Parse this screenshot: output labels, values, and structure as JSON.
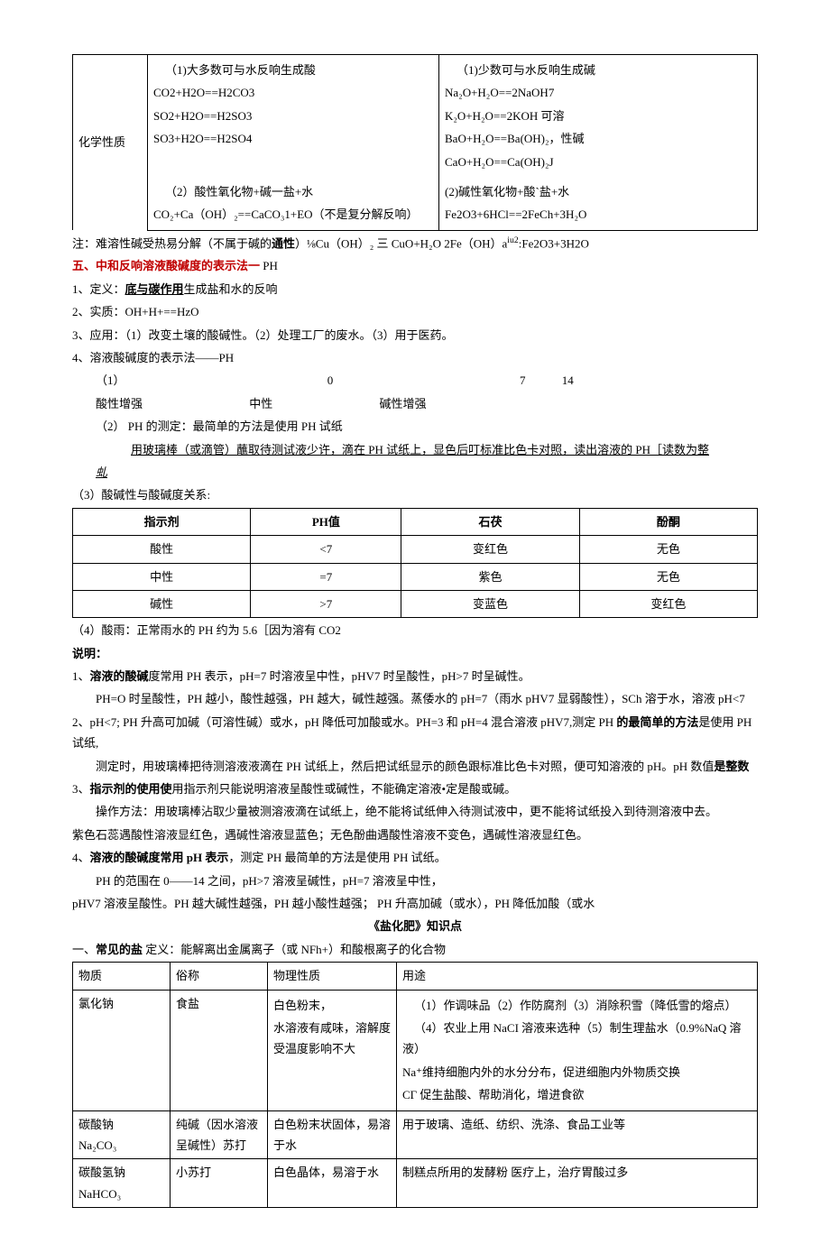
{
  "table1": {
    "rowLabel": "化学性质",
    "c1a": "（1)大多数可与水反响生成酸",
    "c1b1": "CO2+H2O==H2CO3",
    "c1b2": "SO2+H2O==H2SO3",
    "c1b3": "SO3+H2O==H2SO4",
    "c2a": "（1)少数可与水反响生成碱",
    "c2b1": "Na₂O+H₂O==2NaOH7",
    "c2b2": "K₂O+H₂O==2KOH          可溶",
    "c2b3": "BaO+H₂O==Ba(OH)₂，性碱",
    "c2b4": "CaO+H₂O==Ca(OH)₂J",
    "c3a": "（2）酸性氧化物+碱一盐+水",
    "c3b": "CO₂+Ca（OH）₂==CaCO₃1+EO（不是复分解反响）",
    "c4a": "(2)碱性氧化物+酸`盐+水",
    "c4b": "Fe2O3+6HCl==2FeCh+3H₂O"
  },
  "note1": "注：难溶性碱受热易分解（不属于碱的",
  "note1b": "通性",
  "note1c": "）⅛Cu（OH）₂ 三 CuO+H₂O            2Fe（OH）a",
  "note1d": ":Fe2O3+3H2O",
  "note1sup": "iu2",
  "sec5": {
    "title": "五、中和反响溶液酸碱度的表示法一",
    "titleSuffix": " PH",
    "p1a": "1、定义：",
    "p1b": "底与碳作用",
    "p1c": "生成盐和水的反响",
    "p2": "2、实质：OH+H+==HzO",
    "p3": "3、应用：（1）改变土壤的酸碱性。（2）处理工厂的废水。（3）用于医药。",
    "p4": "4、溶液酸碱度的表示法——PH",
    "scale1": "（1）",
    "scale2": "0",
    "scale3": "7",
    "scale4": "14",
    "scaleL": "酸性增强",
    "scaleM": "中性",
    "scaleR": "碱性增强",
    "p42": "（2） PH 的测定：最简单的方法是使用 PH 试纸",
    "p42b": "用玻璃棒（或滴管）蘸取待测试液少许，滴在 PH 试纸上，显色后叮标准比色卡对照，读出溶液的 PH［读数为整",
    "p42c": "虬",
    "p43": "（3）酸碱性与酸碱度关系:"
  },
  "table3": {
    "h1": "指示剂",
    "h2": "PH值",
    "h3": "石茯",
    "h4": "酚酮",
    "r1c1": "酸性",
    "r1c2": "<7",
    "r1c3": "变红色",
    "r1c4": "无色",
    "r2c1": "中性",
    "r2c2": "=7",
    "r2c3": "紫色",
    "r2c4": "无色",
    "r3c1": "碱性",
    "r3c2": ">7",
    "r3c3": "变蓝色",
    "r3c4": "变红色"
  },
  "p44": "（4）酸雨：正常雨水的 PH 约为 5.6［因为溶有 CO2",
  "explain": {
    "title": "说明：",
    "p1a": "1、",
    "p1b": "溶液的酸碱",
    "p1c": "度常用 PH 表示，pH=7 时溶液呈中性，pHV7 时呈酸性，pH>7 时呈碱性。",
    "p1d": "PH=O 时呈酸性，PH 越小，酸性越强，PH 越大，碱性越强。蒸倭水的 pH=7（雨水 pHV7 显弱酸性），SCh 溶于水，溶液 pH<7",
    "p2a": "2、pH<7;  PH 升高可加碱（可溶性碱）或水，pH 降低可加酸或水。PH=3 和 pH=4 混合溶液 pHV7,测定 PH ",
    "p2b": "的最简单的方法",
    "p2c": "是使用 PH 试纸,",
    "p2d": "测定时，用玻璃棒把待测溶液液滴在 PH 试纸上，然后把试纸显示的颜色跟标准比色卡对照，便可知溶液的 pH。pH 数值",
    "p2e": "是整数",
    "p3a": "3、",
    "p3b": "指示剂的使用使",
    "p3c": "用指示剂只能说明溶液呈酸性或碱性，不能确定溶液•定是酸或碱。",
    "p3d": "操作方法：用玻璃棒沾取少量被测溶液滴在试纸上，绝不能将试纸伸入待测试液中，更不能将试纸投入到待测溶液中去。",
    "p3e": "紫色石蕊遇酸性溶液显红色，遇碱性溶液显蓝色；无色酚曲遇酸性溶液不变色，遇碱性溶液显红色。",
    "p4a": "4、",
    "p4b": "溶液的酸碱度常用 pH 表示",
    "p4c": "，测定 PH 最简单的方法是使用 PH 试纸。",
    "p4d": "PH 的范围在 0——14 之间，pH>7 溶液呈碱性，pH=7 溶液呈中性，",
    "p4e": "pHV7 溶液呈酸性。PH 越大碱性越强，PH 越小酸性越强；          PH 升高加碱（或水），PH 降低加酸（或水"
  },
  "fert": {
    "title": "《盐化肥》知识点",
    "p1a": "一、",
    "p1b": "常见的盐",
    "p1c": "      定义：能解离出金属离子（或 NFh+）和酸根离子的化合物"
  },
  "table4": {
    "h1": "物质",
    "h2": "俗称",
    "h3": "物理性质",
    "h4": "用途",
    "r1c1": "氯化钠",
    "r1c2": "食盐",
    "r1c3a": "白色粉末，",
    "r1c3b": "水溶液有咸味，溶解度受温度影响不大",
    "r1c4a": "（1）作调味品（2）作防腐剂（3）消除积雪（降低雪的熔点）",
    "r1c4b": "（4）农业上用 NaCI 溶液来选种（5）制生理盐水（0.9%NaQ 溶液）",
    "r1c4c": "Na⁺维持细胞内外的水分分布，促进细胞内外物质交换",
    "r1c4d": "CΓ 促生盐酸、帮助消化，增进食欲",
    "r2c1a": "碳酸钠",
    "r2c1b": "Na₂CO₃",
    "r2c2": "纯碱（因水溶液呈碱性）苏打",
    "r2c3": "白色粉末状固体，易溶于水",
    "r2c4": "用于玻璃、造纸、纺织、洗涤、食品工业等",
    "r3c1": "碳酸氢钠 NaHCO₃",
    "r3c2": "小苏打",
    "r3c3": "白色晶体，易溶于水",
    "r3c4": "制糕点所用的发酵粉      医疗上，治疗胃酸过多"
  }
}
